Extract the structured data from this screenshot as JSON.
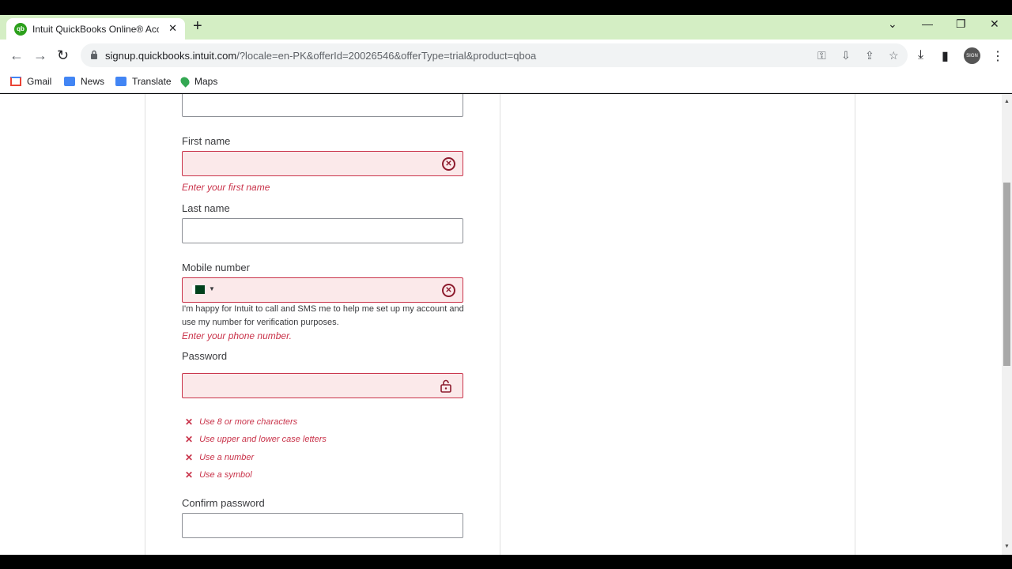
{
  "browser": {
    "tab_title": "Intuit QuickBooks Online® Acco",
    "tab_favicon": "qb",
    "url_host": "signup.quickbooks.intuit.com",
    "url_path": "/?locale=en-PK&offerId=20026546&offerType=trial&product=qboa",
    "avatar_text": "SIGN",
    "bookmarks": [
      {
        "label": "Gmail",
        "icon": "gmail-icon"
      },
      {
        "label": "News",
        "icon": "news-icon"
      },
      {
        "label": "Translate",
        "icon": "translate-icon"
      },
      {
        "label": "Maps",
        "icon": "maps-icon"
      }
    ]
  },
  "form": {
    "first_name_label": "First name",
    "first_name_value": "",
    "first_name_error": "Enter your first name",
    "last_name_label": "Last name",
    "last_name_value": "",
    "mobile_label": "Mobile number",
    "mobile_value": "",
    "mobile_country": "PK",
    "mobile_hint": "I'm happy for Intuit to call and SMS me to help me set up my account and use my number for verification purposes.",
    "mobile_error": "Enter your phone number.",
    "password_label": "Password",
    "password_value": "",
    "password_rules": [
      "Use 8 or more characters",
      "Use upper and lower case letters",
      "Use a number",
      "Use a symbol"
    ],
    "confirm_password_label": "Confirm password",
    "confirm_password_value": ""
  },
  "colors": {
    "error": "#c9334a",
    "error_bg": "#fbe9ea",
    "tabstrip": "#d4eec4"
  }
}
